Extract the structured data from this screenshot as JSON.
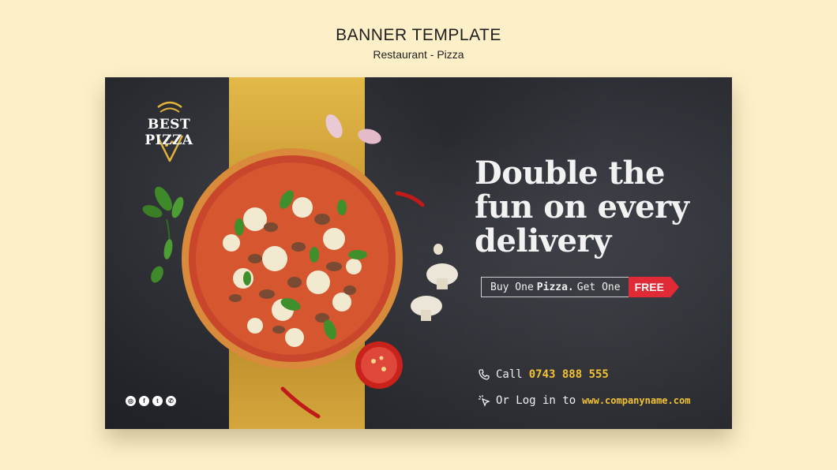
{
  "header": {
    "title": "BANNER TEMPLATE",
    "subtitle": "Restaurant - Pizza"
  },
  "banner": {
    "logo_text": "BEST PIZZA",
    "headline": [
      "Double the",
      "fun on every",
      "delivery"
    ],
    "offer": {
      "prefix": "Buy One",
      "bold": "Pizza.",
      "suffix": "Get One",
      "tag": "FREE"
    },
    "contact": {
      "call_label": "Call",
      "phone": "0743 888 555",
      "login_label": "Or Log in to",
      "website": "www.companyname.com"
    },
    "social_icons": [
      "instagram-icon",
      "facebook-icon",
      "twitter-icon",
      "whatsapp-icon"
    ]
  },
  "colors": {
    "background": "#fdf0c8",
    "slate": "#2b2d33",
    "gold": "#d4a73d",
    "accent_red": "#e02b37",
    "highlight_yellow": "#f3c234"
  }
}
